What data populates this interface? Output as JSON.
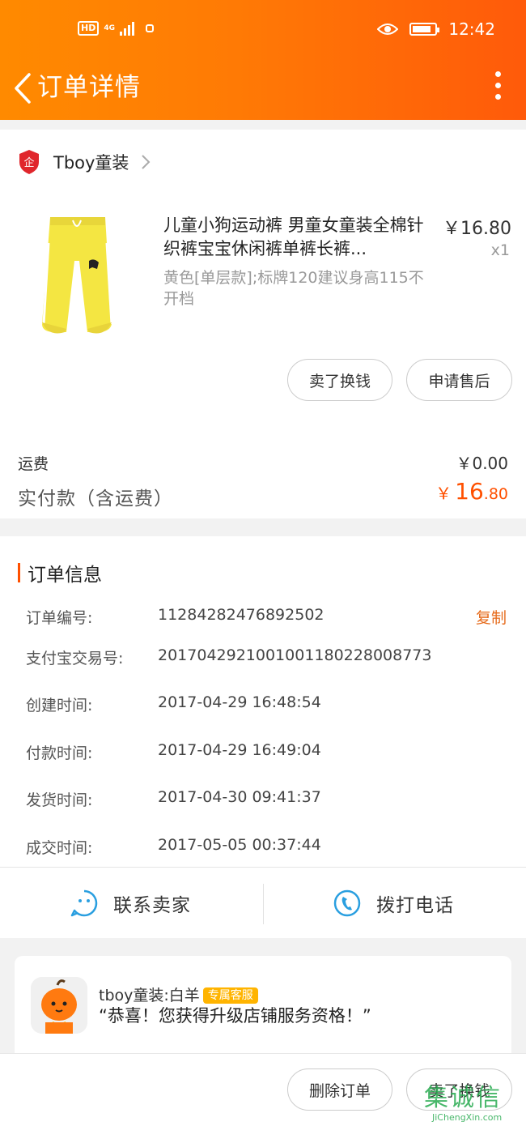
{
  "status_bar": {
    "network": "4G",
    "hd": "HD",
    "time": "12:42"
  },
  "header": {
    "title": "订单详情"
  },
  "shop": {
    "name": "Tboy童装",
    "logo_text": "企"
  },
  "product": {
    "title": "儿童小狗运动裤 男童女童装全棉针织裤宝宝休闲裤单裤长裤...",
    "spec": "黄色[单层款];标牌120建议身高115不开档",
    "price": "￥16.80",
    "qty": "x1"
  },
  "item_actions": {
    "sell": "卖了换钱",
    "after_sale": "申请售后"
  },
  "summary": {
    "shipping_label": "运费",
    "shipping_value": "￥0.00",
    "paid_label": "实付款（含运费）",
    "paid_currency": "￥",
    "paid_int": "16",
    "paid_dec": ".80"
  },
  "order_info": {
    "title": "订单信息",
    "copy_label": "复制",
    "rows": [
      {
        "label": "订单编号:",
        "value": "11284282476892502"
      },
      {
        "label": "支付宝交易号:",
        "value": "2017042921001001180228008773"
      },
      {
        "label": "创建时间:",
        "value": "2017-04-29 16:48:54"
      },
      {
        "label": "付款时间:",
        "value": "2017-04-29 16:49:04"
      },
      {
        "label": "发货时间:",
        "value": "2017-04-30 09:41:37"
      },
      {
        "label": "成交时间:",
        "value": "2017-05-05 00:37:44"
      }
    ]
  },
  "contact": {
    "seller": "联系卖家",
    "phone": "拨打电话"
  },
  "promo": {
    "name": "tboy童装:白羊",
    "badge": "专属客服",
    "message": "“恭喜！您获得升级店铺服务资格！”"
  },
  "bottom_actions": {
    "delete": "删除订单",
    "sell": "卖了换钱"
  },
  "watermark": {
    "text": "集诚信",
    "sub": "JiChengXin.com"
  },
  "colors": {
    "accent": "#ff5000",
    "header_start": "#ff8a00",
    "header_end": "#ff5a0a",
    "link": "#e66a1a",
    "icon_blue": "#2a9fe0"
  }
}
